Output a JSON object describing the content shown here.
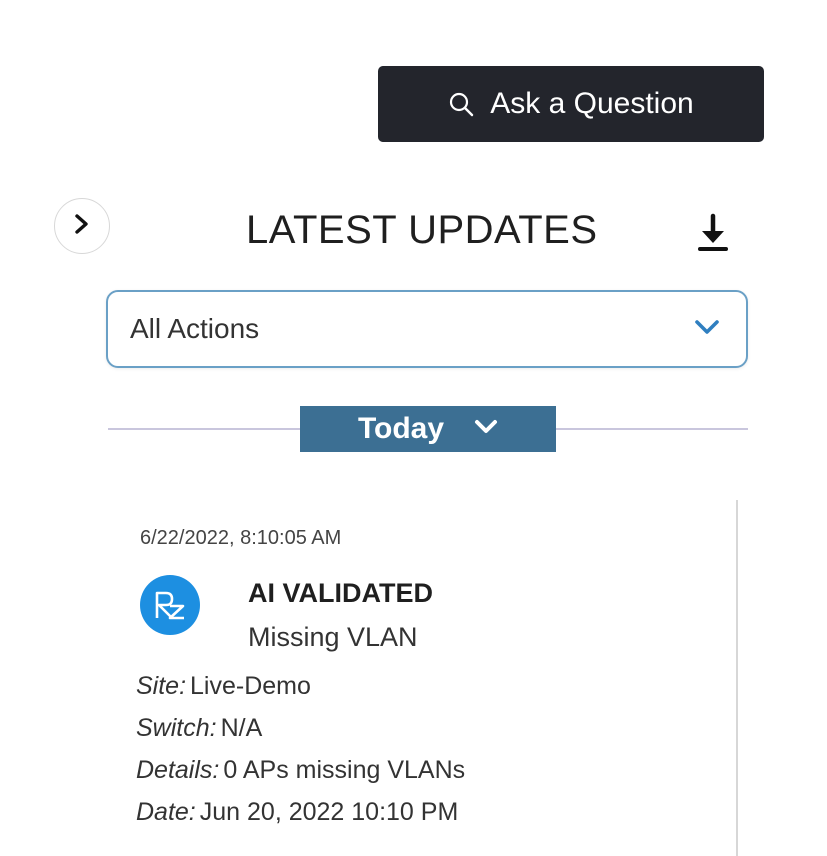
{
  "header": {
    "ask_button_label": "Ask a Question",
    "panel_title": "LATEST UPDATES"
  },
  "filter": {
    "selected": "All Actions"
  },
  "group": {
    "label": "Today"
  },
  "update": {
    "timestamp": "6/22/2022, 8:10:05 AM",
    "status": "AI VALIDATED",
    "issue": "Missing VLAN",
    "avatar_icon": "rz-logo-icon",
    "details": [
      {
        "key": "Site:",
        "value": "Live-Demo"
      },
      {
        "key": "Switch:",
        "value": "N/A"
      },
      {
        "key": "Details:",
        "value": "0 APs missing VLANs"
      },
      {
        "key": "Date:",
        "value": "Jun 20, 2022 10:10 PM"
      }
    ]
  },
  "colors": {
    "button_dark": "#23252c",
    "accent_blue": "#3c6f93",
    "avatar_blue": "#1d8fe1",
    "select_border": "#6aa0c6"
  }
}
